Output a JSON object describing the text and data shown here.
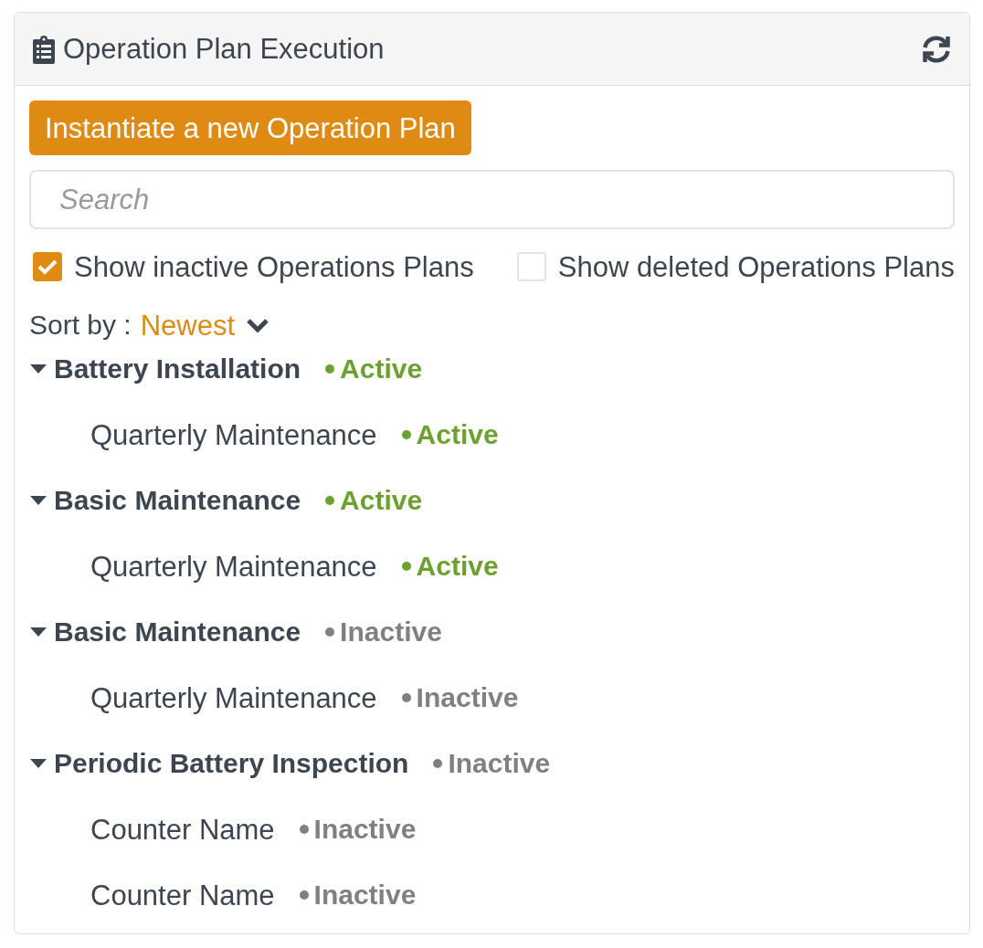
{
  "panel": {
    "title": "Operation Plan Execution"
  },
  "new_plan_button": {
    "label": "Instantiate a new Operation Plan"
  },
  "search": {
    "placeholder": "Search"
  },
  "filters": [
    {
      "label": "Show inactive Operations Plans",
      "checked": true
    },
    {
      "label": "Show deleted Operations Plans",
      "checked": false
    }
  ],
  "sort": {
    "label": "Sort by :",
    "value": "Newest"
  },
  "plans": [
    {
      "name": "Battery Installation",
      "status": "Active",
      "color": "#6ca12f",
      "expanded": true,
      "children": [
        {
          "name": "Quarterly Maintenance",
          "status": "Active",
          "color": "#6ca12f"
        }
      ]
    },
    {
      "name": "Basic Maintenance",
      "status": "Active",
      "color": "#6ca12f",
      "expanded": true,
      "children": [
        {
          "name": "Quarterly Maintenance",
          "status": "Active",
          "color": "#6ca12f"
        }
      ]
    },
    {
      "name": "Basic Maintenance",
      "status": "Inactive",
      "color": "#808080",
      "expanded": true,
      "children": [
        {
          "name": "Quarterly Maintenance",
          "status": "Inactive",
          "color": "#808080"
        }
      ]
    },
    {
      "name": "Periodic Battery Inspection",
      "status": "Inactive",
      "color": "#808080",
      "expanded": true,
      "children": [
        {
          "name": "Counter Name",
          "status": "Inactive",
          "color": "#808080"
        },
        {
          "name": "Counter Name",
          "status": "Inactive",
          "color": "#808080"
        }
      ]
    }
  ]
}
